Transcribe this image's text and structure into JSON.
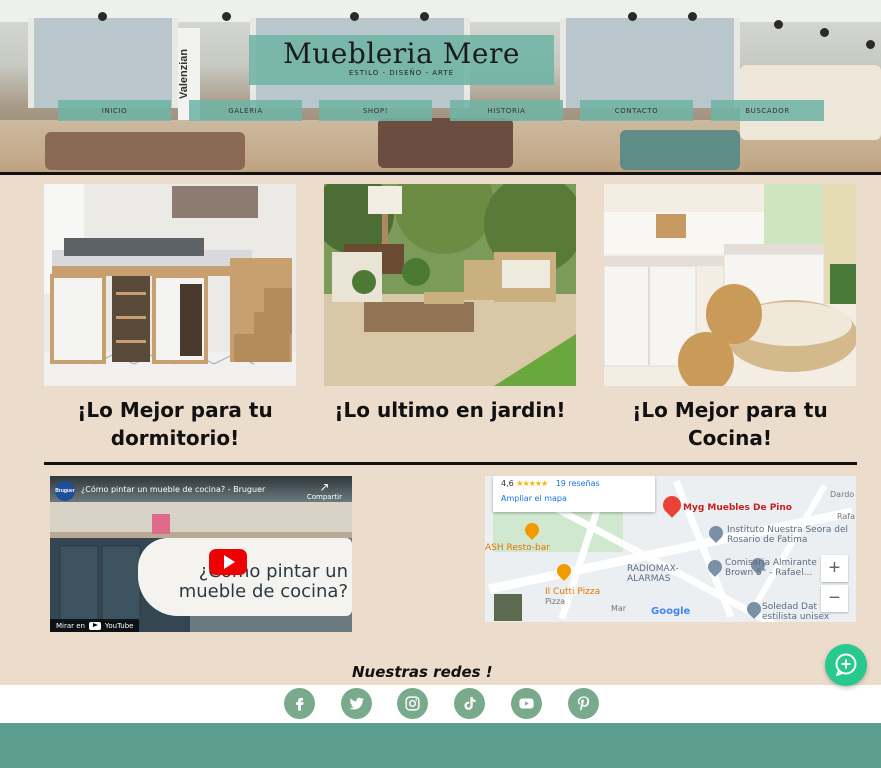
{
  "brand": {
    "title": "Muebleria Mere",
    "subtitle": "ESTILO - DISEÑO - ARTE"
  },
  "nav": [
    "INICIO",
    "GALERIA",
    "SHOP!",
    "HISTORIA",
    "CONTACTO",
    "BUSCADOR"
  ],
  "hero_sign": "Valenzian",
  "cards": [
    {
      "title": "¡Lo Mejor para tu dormitorio!",
      "image": "bedroom-loft-bed"
    },
    {
      "title": "¡Lo ultimo en jardin!",
      "image": "garden-patio-furniture"
    },
    {
      "title": "¡Lo Mejor para tu Cocina!",
      "image": "kitchen-dining"
    }
  ],
  "video": {
    "channel_logo": "Bruguer",
    "title": "¿Cómo pintar un mueble de cocina? - Bruguer",
    "share_label": "Compartir",
    "overlay_text": "¿Cómo pintar un mueble de cocina?",
    "watch_on": "Mirar en",
    "platform": "YouTube"
  },
  "map": {
    "rating": "4,6",
    "stars": "★★★★★",
    "reviews": "19 reseñas",
    "enlarge_link": "Ampliar el mapa",
    "place": "Myg Muebles De Pino",
    "labels": {
      "instituto": "Instituto Nuestra Seora del Rosario de Fatima",
      "resto": "ASH Resto-bar",
      "radiomax": "RADIOMAX-ALARMAS",
      "comisaria": "Comisaria Almirante Brown 5° - Rafael...",
      "pizza": "Il Cutti Pizza",
      "pizza_sub": "Pizza",
      "soledad": "Soledad Dat estilista unisex",
      "dardo": "Dardo",
      "rafa": "Rafa",
      "mar": "Mar"
    },
    "zoom_in": "+",
    "zoom_out": "−",
    "logo": "Google"
  },
  "social": {
    "heading": "Nuestras redes !",
    "networks": [
      "facebook",
      "twitter",
      "instagram",
      "tiktok",
      "youtube",
      "pinterest"
    ]
  },
  "colors": {
    "teal": "#70b4a5",
    "footer": "#5c9e90",
    "social": "#7aaa8c",
    "background": "#ecdccb",
    "chat": "#27c98f"
  }
}
